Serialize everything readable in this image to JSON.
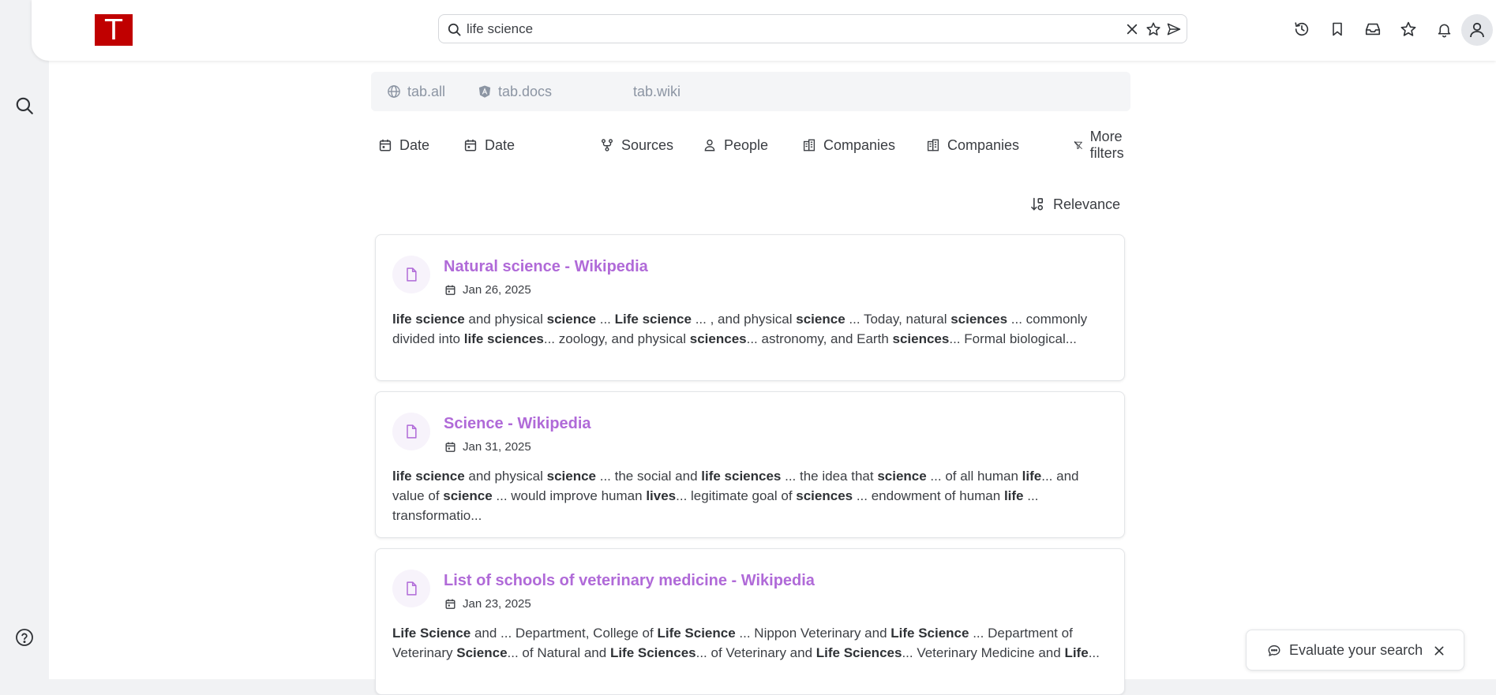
{
  "app": {
    "logo_letter": "T",
    "brand_color": "#c00000",
    "accent_color": "#b06ad8"
  },
  "left_rail": {
    "items": [
      {
        "icon": "search-icon"
      }
    ],
    "footer": {
      "icon": "help-icon"
    }
  },
  "search": {
    "value": "life science",
    "icons": [
      "search-icon",
      "clear-icon",
      "star-icon",
      "send-icon"
    ]
  },
  "top_actions": [
    "history-icon",
    "bookmark-icon",
    "inbox-icon",
    "star-icon",
    "bell-icon",
    "user-avatar"
  ],
  "tabs": [
    {
      "label": "tab.all",
      "icon": "globe-icon"
    },
    {
      "label": "tab.docs",
      "icon": "angular-icon"
    },
    {
      "label": "tab.wiki",
      "icon": ""
    }
  ],
  "filters": [
    {
      "label": "Date",
      "icon": "calendar-icon"
    },
    {
      "label": "Date",
      "icon": "calendar-icon"
    },
    {
      "label": "Sources",
      "icon": "sources-icon"
    },
    {
      "label": "People",
      "icon": "person-icon"
    },
    {
      "label": "Companies",
      "icon": "building-icon"
    },
    {
      "label": "Companies",
      "icon": "building-icon"
    },
    {
      "label": "More filters",
      "icon": "filter-icon"
    }
  ],
  "sort": {
    "label": "Relevance",
    "icon": "sort-icon"
  },
  "results": [
    {
      "title": "Natural science - Wikipedia",
      "date": "Jan 26, 2025",
      "snippet": [
        {
          "t": "life science",
          "b": true
        },
        {
          "t": " and physical "
        },
        {
          "t": "science",
          "b": true
        },
        {
          "t": " ... "
        },
        {
          "t": "Life science",
          "b": true
        },
        {
          "t": " ... , and physical "
        },
        {
          "t": "science",
          "b": true
        },
        {
          "t": " ... Today, natural "
        },
        {
          "t": "sciences",
          "b": true
        },
        {
          "t": " ... commonly divided into "
        },
        {
          "t": "life sciences",
          "b": true
        },
        {
          "t": "... zoology, and physical "
        },
        {
          "t": "sciences",
          "b": true
        },
        {
          "t": "... astronomy, and Earth "
        },
        {
          "t": "sciences",
          "b": true
        },
        {
          "t": "... Formal biological..."
        }
      ]
    },
    {
      "title": "Science - Wikipedia",
      "date": "Jan 31, 2025",
      "snippet": [
        {
          "t": "life science",
          "b": true
        },
        {
          "t": " and physical "
        },
        {
          "t": "science",
          "b": true
        },
        {
          "t": " ... the social and "
        },
        {
          "t": "life sciences",
          "b": true
        },
        {
          "t": " ... the idea that "
        },
        {
          "t": "science",
          "b": true
        },
        {
          "t": " ... of all human "
        },
        {
          "t": "life",
          "b": true
        },
        {
          "t": "... and value of "
        },
        {
          "t": "science",
          "b": true
        },
        {
          "t": " ... would improve human "
        },
        {
          "t": "lives",
          "b": true
        },
        {
          "t": "... legitimate goal of "
        },
        {
          "t": "sciences",
          "b": true
        },
        {
          "t": " ... endowment of human "
        },
        {
          "t": "life",
          "b": true
        },
        {
          "t": " ... transformatio..."
        }
      ]
    },
    {
      "title": "List of schools of veterinary medicine - Wikipedia",
      "date": "Jan 23, 2025",
      "snippet": [
        {
          "t": "Life Science",
          "b": true
        },
        {
          "t": " and ... Department, College of "
        },
        {
          "t": "Life Science",
          "b": true
        },
        {
          "t": " ... Nippon Veterinary and "
        },
        {
          "t": "Life Science",
          "b": true
        },
        {
          "t": " ... Department of Veterinary "
        },
        {
          "t": "Science",
          "b": true
        },
        {
          "t": "... of Natural and "
        },
        {
          "t": "Life Sciences",
          "b": true
        },
        {
          "t": "... of Veterinary and "
        },
        {
          "t": "Life Sciences",
          "b": true
        },
        {
          "t": "... Veterinary Medicine and "
        },
        {
          "t": "Life",
          "b": true
        },
        {
          "t": "..."
        }
      ]
    }
  ],
  "evaluate": {
    "label": "Evaluate your search"
  }
}
